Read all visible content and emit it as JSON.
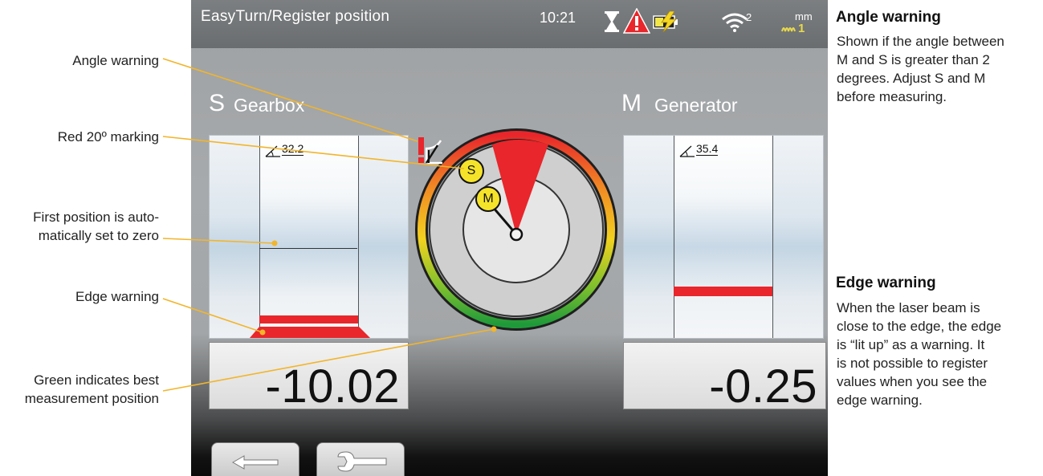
{
  "callouts": [
    {
      "id": "angle",
      "text": "Angle warning"
    },
    {
      "id": "red20",
      "text": "Red 20º marking"
    },
    {
      "id": "zero",
      "line1": "First position is auto-",
      "line2": "matically set to zero"
    },
    {
      "id": "edge",
      "text": "Edge warning"
    },
    {
      "id": "green",
      "line1": "Green indicates best",
      "line2": "measurement position"
    }
  ],
  "notes": {
    "angle_warning": {
      "title": "Angle warning",
      "lines": [
        "Shown if the angle between",
        "M and S is greater than 2",
        "degrees. Adjust S and M",
        "before measuring."
      ]
    },
    "edge_warning": {
      "title": "Edge warning",
      "lines": [
        "When the laser beam is",
        "close to the edge, the edge",
        "is “lit up” as a warning. It",
        "is not possible to register",
        "values when you see the",
        "edge warning."
      ]
    }
  },
  "screen": {
    "title": "EasyTurn/Register position",
    "time": "10:21",
    "wifi_level": "2",
    "unit": "mm",
    "unit_sub": "1",
    "icons": [
      "hourglass-icon",
      "warning-triangle-icon",
      "battery-charging-icon",
      "wifi-icon"
    ],
    "left": {
      "letter": "S",
      "name": "Gearbox",
      "angle": "32.2",
      "value": "-10.02"
    },
    "right": {
      "letter": "M",
      "name": "Generator",
      "angle": "35.4",
      "value": "-0.25"
    },
    "dial": {
      "marker_s": "S",
      "marker_m": "M"
    },
    "buttons": [
      "back-arrow-icon",
      "wrench-icon"
    ]
  },
  "colors": {
    "warning_red": "#e8262b",
    "callout_line": "#f2b52b",
    "best_green": "#1f9a3a"
  }
}
